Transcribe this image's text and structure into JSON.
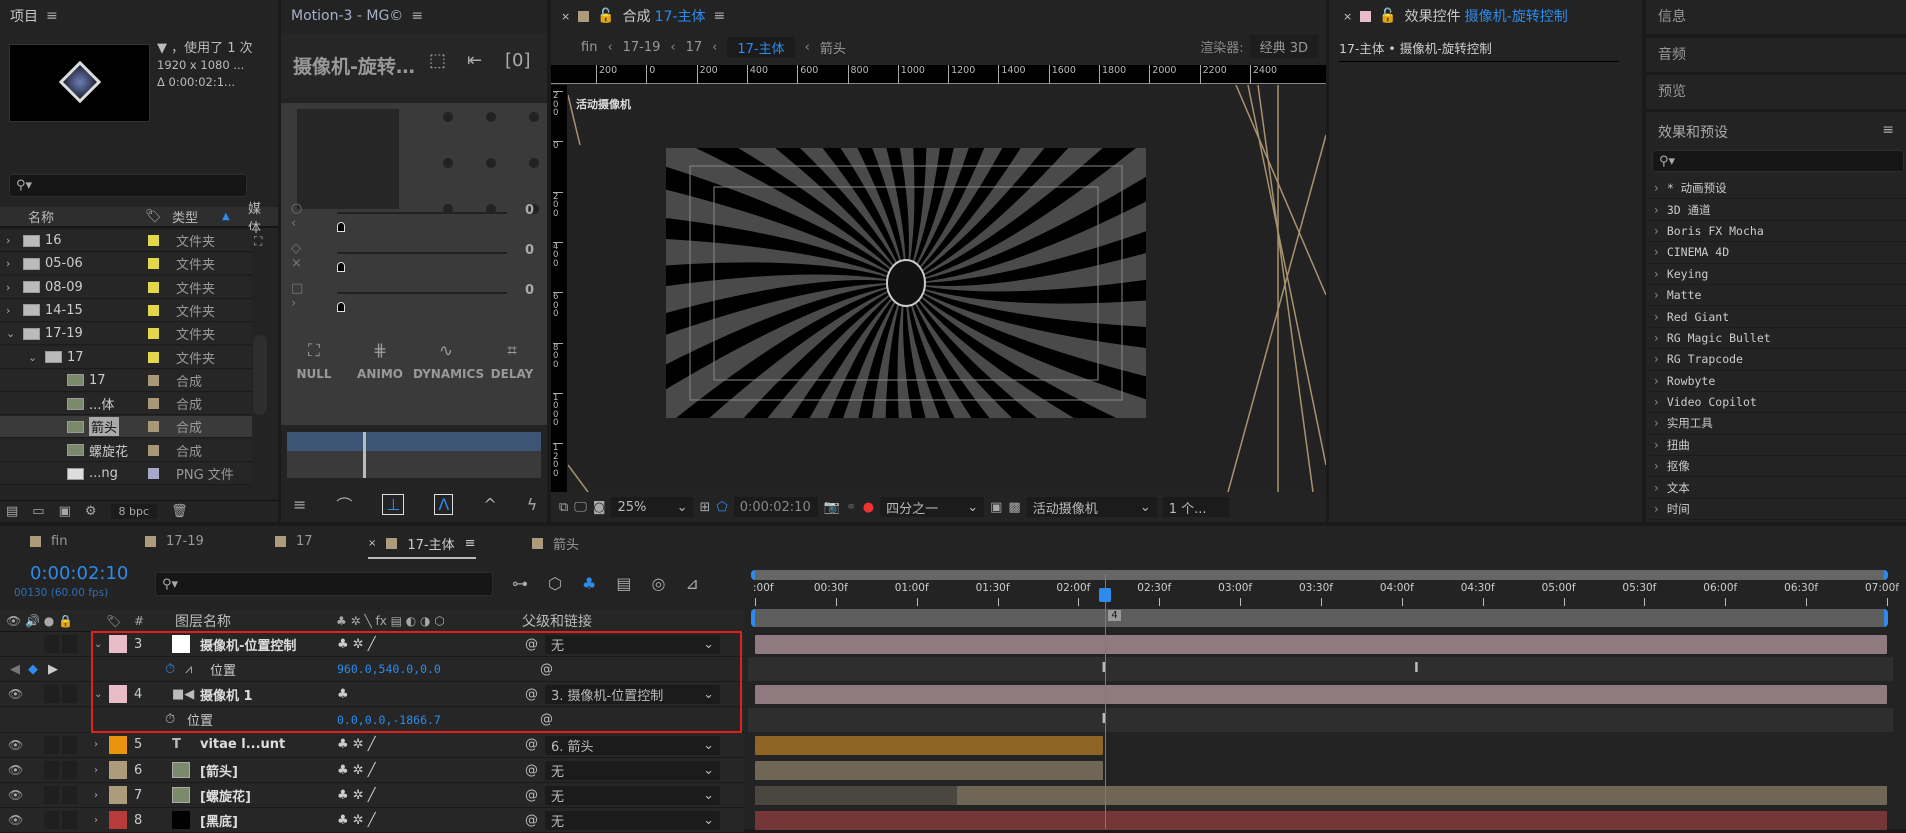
{
  "project": {
    "title": "项目",
    "info_line1": "▼ ，使用了 1 次",
    "info_line2": "1920 x 1080 ...",
    "info_line3": "Δ 0:00:02:1...",
    "columns": {
      "name": "名称",
      "type": "类型",
      "media": "媒体"
    },
    "items": [
      {
        "indent": 0,
        "expand": "›",
        "icon": "folder",
        "name": "16",
        "color": "#e3d64a",
        "type": "文件夹"
      },
      {
        "indent": 0,
        "expand": "›",
        "icon": "folder",
        "name": "05-06",
        "color": "#e3d64a",
        "type": "文件夹"
      },
      {
        "indent": 0,
        "expand": "›",
        "icon": "folder",
        "name": "08-09",
        "color": "#e3d64a",
        "type": "文件夹"
      },
      {
        "indent": 0,
        "expand": "›",
        "icon": "folder",
        "name": "14-15",
        "color": "#e3d64a",
        "type": "文件夹"
      },
      {
        "indent": 0,
        "expand": "⌄",
        "icon": "folder",
        "name": "17-19",
        "color": "#e3d64a",
        "type": "文件夹"
      },
      {
        "indent": 1,
        "expand": "⌄",
        "icon": "folder",
        "name": "17",
        "color": "#e3d64a",
        "type": "文件夹"
      },
      {
        "indent": 2,
        "expand": "",
        "icon": "comp",
        "name": "17",
        "color": "#a89878",
        "type": "合成"
      },
      {
        "indent": 2,
        "expand": "",
        "icon": "comp",
        "name": "...体",
        "color": "#a89878",
        "type": "合成"
      },
      {
        "indent": 2,
        "expand": "",
        "icon": "comp",
        "name": "箭头",
        "color": "#a89878",
        "type": "合成",
        "selected": true
      },
      {
        "indent": 2,
        "expand": "",
        "icon": "comp",
        "name": "螺旋花",
        "color": "#a89878",
        "type": "合成"
      },
      {
        "indent": 2,
        "expand": "",
        "icon": "png",
        "name": "...ng",
        "color": "#a8a8cc",
        "type": "PNG 文件"
      }
    ],
    "bpc": "8 bpc"
  },
  "motion": {
    "title": "Motion-3 - MG©",
    "layer_name": "摄像机-旋转…",
    "slider_values": [
      "0",
      "0",
      "0"
    ],
    "tools": [
      "NULL",
      "ANIMO",
      "DYNAMICS",
      "DELAY"
    ]
  },
  "viewer": {
    "tab_prefix": "合成",
    "tab_name": "17-主体",
    "breadcrumbs": [
      "fin",
      "17-19",
      "17",
      "17-主体",
      "箭头"
    ],
    "active_crumb": 3,
    "renderer_label": "渲染器:",
    "renderer_value": "经典 3D",
    "ruler_ticks": [
      "200",
      "0",
      "200",
      "400",
      "600",
      "800",
      "1000",
      "1200",
      "1400",
      "1600",
      "1800",
      "2000",
      "2200",
      "2400"
    ],
    "vruler_ticks": [
      "200",
      "0",
      "200",
      "400",
      "600",
      "800",
      "1000",
      "1200"
    ],
    "camera_label": "活动摄像机",
    "toolbar": {
      "zoom": "25%",
      "timecode": "0:00:02:10",
      "resolution": "四分之一",
      "view": "活动摄像机",
      "views_count": "1 个..."
    }
  },
  "effects_controls": {
    "title": "效果控件",
    "layer": "摄像机-旋转控制",
    "path": "17-主体 • 摄像机-旋转控制"
  },
  "right_panel": {
    "sections": [
      "信息",
      "音频",
      "预览"
    ],
    "effects_title": "效果和预设",
    "effects": [
      "* 动画预设",
      "3D 通道",
      "Boris FX Mocha",
      "CINEMA 4D",
      "Keying",
      "Matte",
      "Red Giant",
      "RG Magic Bullet",
      "RG Trapcode",
      "Rowbyte",
      "Video Copilot",
      "实用工具",
      "扭曲",
      "抠像",
      "文本",
      "时间"
    ]
  },
  "timeline": {
    "tabs": [
      {
        "name": "fin"
      },
      {
        "name": "17-19"
      },
      {
        "name": "17"
      },
      {
        "name": "17-主体",
        "active": true
      },
      {
        "name": "箭头"
      }
    ],
    "timecode": "0:00:02:10",
    "frame_info": "00130 (60.00 fps)",
    "headers": {
      "num": "#",
      "layer_name": "图层名称",
      "parent": "父级和链接"
    },
    "time_labels": [
      ":00f",
      "00:30f",
      "01:00f",
      "01:30f",
      "02:00f",
      "02:30f",
      "03:00f",
      "03:30f",
      "04:00f",
      "04:30f",
      "05:00f",
      "05:30f",
      "06:00f",
      "06:30f",
      "07:00f"
    ],
    "playhead_seconds": 2.167,
    "duration_seconds": 7.0,
    "marker_label": "4",
    "layers": [
      {
        "kind": "layer",
        "num": "3",
        "label_color": "#e8bcc8",
        "icon": "solid-white",
        "name": "摄像机-位置控制",
        "parent": "无",
        "expanded": true,
        "bar": [
          0,
          7
        ],
        "bar_color": "#8f7a80"
      },
      {
        "kind": "prop",
        "name": "位置",
        "value": "960.0,540.0,0.0",
        "keyframes": [
          2.167,
          4.1
        ],
        "animated": true
      },
      {
        "kind": "layer",
        "num": "4",
        "label_color": "#e8bcc8",
        "icon": "camera",
        "name": "摄像机 1",
        "parent": "3. 摄像机-位置控制",
        "expanded": true,
        "bar": [
          0,
          7
        ],
        "bar_color": "#8f7a80"
      },
      {
        "kind": "prop",
        "name": "位置",
        "value": "0.0,0.0,-1866.7",
        "keyframes": [
          2.167
        ],
        "animated": false
      },
      {
        "kind": "layer",
        "num": "5",
        "label_color": "#e8940c",
        "icon": "text",
        "name": "vitae l...unt",
        "parent": "6. 箭头",
        "bar": [
          0,
          2.15
        ],
        "bar_color": "#8f6525"
      },
      {
        "kind": "layer",
        "num": "6",
        "label_color": "#ad9c7c",
        "icon": "comp",
        "name": "[箭头]",
        "parent": "无",
        "bar": [
          0,
          2.15
        ],
        "bar_color": "#706656"
      },
      {
        "kind": "layer",
        "num": "7",
        "label_color": "#ad9c7c",
        "icon": "comp",
        "name": "[螺旋花]",
        "parent": "无",
        "bar": [
          0,
          7
        ],
        "bar_color": "#706656",
        "inactive_until": 1.25
      },
      {
        "kind": "layer",
        "num": "8",
        "label_color": "#b83a3a",
        "icon": "solid-black",
        "name": "[黑底]",
        "parent": "无",
        "bar": [
          0,
          7
        ],
        "bar_color": "#743636"
      }
    ]
  },
  "colors": {
    "accent": "#2d8ceb",
    "selection_box": "#e0201e"
  }
}
